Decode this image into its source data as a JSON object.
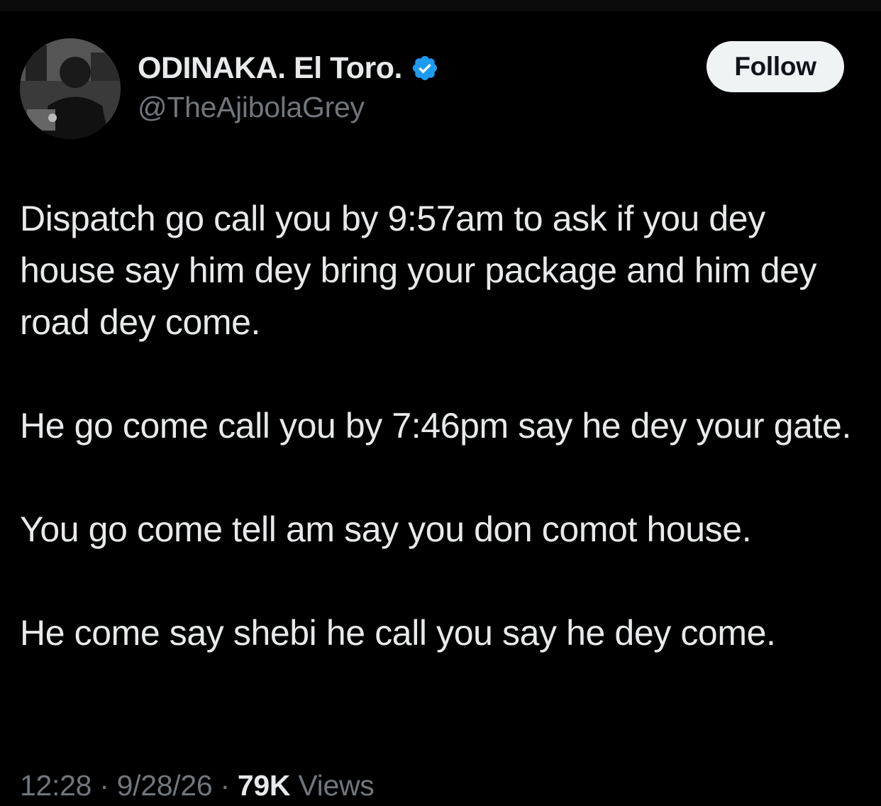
{
  "author": {
    "display_name": "ODINAKA. El Toro.",
    "handle": "@TheAjibolaGrey",
    "verified_icon": "verified-badge-icon",
    "avatar": "profile-photo"
  },
  "actions": {
    "follow_label": "Follow"
  },
  "tweet": {
    "paragraphs": [
      "Dispatch go call you by 9:57am to ask if you dey house say him dey bring your package and him dey road dey come.",
      "He go come call you by 7:46pm say he dey your gate.",
      "You go come tell am say you don comot house.",
      "He come say shebi he call you say he dey come."
    ]
  },
  "meta": {
    "time": "12:28",
    "separator": "·",
    "date": "9/28/26",
    "views_count": "79K",
    "views_label": "Views"
  },
  "colors": {
    "background": "#000000",
    "text_primary": "#e7e9ea",
    "text_secondary": "#71767b",
    "verified_blue": "#1d9bf0",
    "follow_bg": "#eff3f4"
  }
}
